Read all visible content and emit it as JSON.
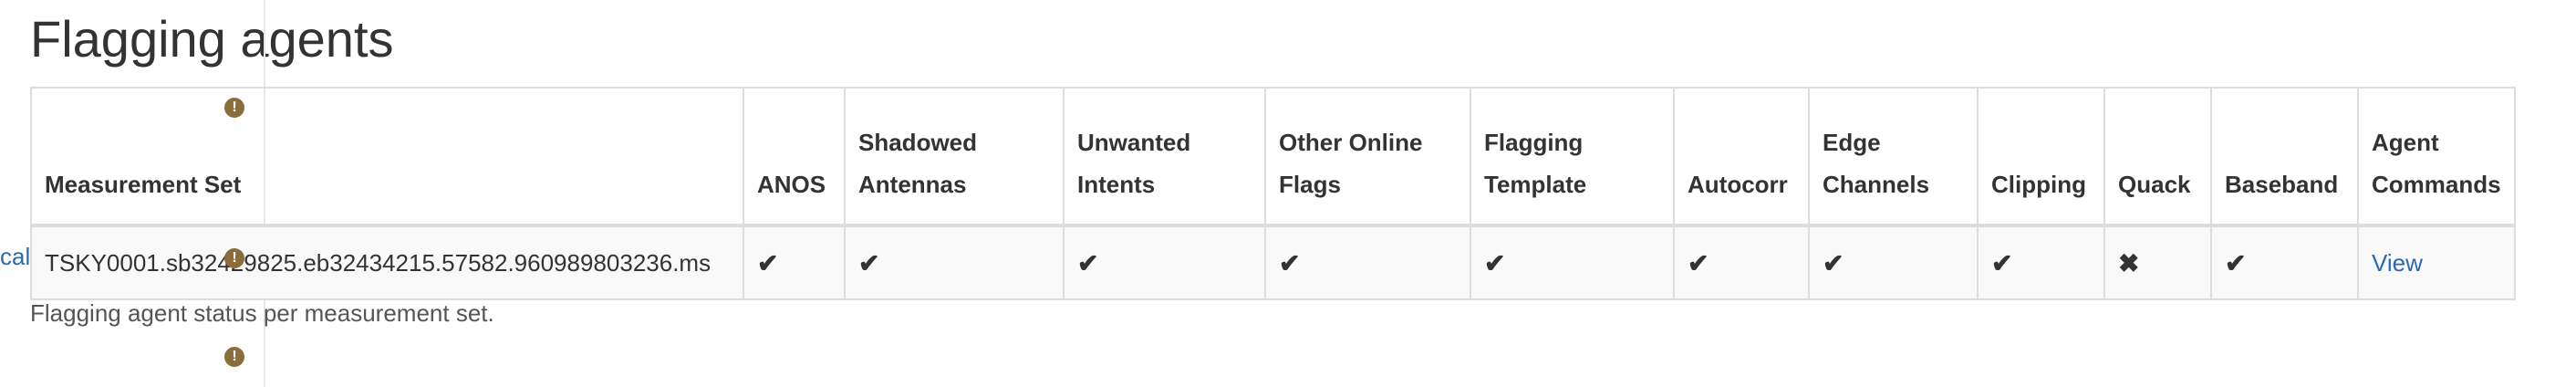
{
  "page": {
    "title": "Flagging agents"
  },
  "side_link": "cals",
  "table": {
    "columns": [
      "Measurement Set",
      "ANOS",
      "Shadowed Antennas",
      "Unwanted Intents",
      "Other Online Flags",
      "Flagging Template",
      "Autocorr",
      "Edge Channels",
      "Clipping",
      "Quack",
      "Baseband",
      "Agent Commands"
    ],
    "rows": [
      {
        "measurement_set": "TSKY0001.sb32429825.eb32434215.57582.960989803236.ms",
        "anos": "✔",
        "shadowed_antennas": "✔",
        "unwanted_intents": "✔",
        "other_online_flags": "✔",
        "flagging_template": "✔",
        "autocorr": "✔",
        "edge_channels": "✔",
        "clipping": "✔",
        "quack": "✖",
        "baseband": "✔",
        "agent_commands": "View"
      }
    ]
  },
  "caption": "Flagging agent status per measurement set.",
  "icons": {
    "warning": "exclamation-circle-icon",
    "check": "check-icon",
    "cross": "cross-icon"
  },
  "colors": {
    "link": "#2a6ab0",
    "warning": "#8a6d3b"
  }
}
